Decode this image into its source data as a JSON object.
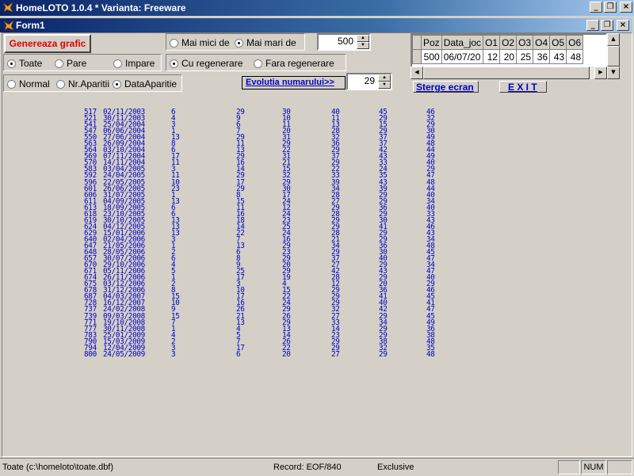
{
  "window": {
    "title": "HomeLOTO 1.0.4 * Varianta: Freeware"
  },
  "form": {
    "title": "Form1"
  },
  "window_buttons": {
    "minimize": "_",
    "restore": "❐",
    "close": "×"
  },
  "controls": {
    "generate_button": "Genereaza grafic",
    "filter_radios": {
      "all": "Toate",
      "even": "Pare",
      "odd": "Impare",
      "selected": "all"
    },
    "compare_radios": {
      "less": "Mai mici de",
      "greater": "Mai mari de",
      "selected": "greater"
    },
    "compare_value": "500",
    "regen_radios": {
      "with": "Cu regenerare",
      "without": "Fara regenerare",
      "selected": "with"
    },
    "mode_radios": {
      "normal": "Normal",
      "count": "Nr.Aparitii",
      "date": "DataAparitie",
      "selected": "date"
    },
    "evolution_button": "Evolutia numarului>>",
    "number_value": "29",
    "clear_button": "Sterge ecran",
    "exit_button": "E X I T"
  },
  "grid": {
    "columns": [
      "Poz",
      "Data_joc",
      "O1",
      "O2",
      "O3",
      "O4",
      "O5",
      "O6"
    ],
    "rows": [
      [
        "500",
        "06/07/20",
        "12",
        "20",
        "25",
        "36",
        "43",
        "48"
      ]
    ]
  },
  "draws": [
    [
      "517",
      "02/11/2003",
      "6",
      "29",
      "30",
      "40",
      "45",
      "46"
    ],
    [
      "521",
      "30/11/2003",
      "4",
      "9",
      "10",
      "11",
      "29",
      "32"
    ],
    [
      "541",
      "25/04/2004",
      "3",
      "6",
      "11",
      "13",
      "15",
      "29"
    ],
    [
      "547",
      "06/06/2004",
      "1",
      "7",
      "20",
      "28",
      "29",
      "30"
    ],
    [
      "550",
      "27/06/2004",
      "13",
      "29",
      "31",
      "32",
      "37",
      "49"
    ],
    [
      "563",
      "26/09/2004",
      "8",
      "11",
      "29",
      "36",
      "37",
      "48"
    ],
    [
      "564",
      "03/10/2004",
      "6",
      "13",
      "22",
      "29",
      "42",
      "44"
    ],
    [
      "569",
      "07/11/2004",
      "17",
      "29",
      "31",
      "37",
      "43",
      "49"
    ],
    [
      "570",
      "14/11/2004",
      "11",
      "16",
      "21",
      "29",
      "33",
      "40"
    ],
    [
      "583",
      "03/04/2005",
      "3",
      "14",
      "15",
      "22",
      "24",
      "29"
    ],
    [
      "592",
      "24/04/2005",
      "11",
      "29",
      "32",
      "33",
      "35",
      "47"
    ],
    [
      "596",
      "22/05/2005",
      "10",
      "17",
      "29",
      "39",
      "43",
      "48"
    ],
    [
      "601",
      "26/06/2005",
      "23",
      "29",
      "30",
      "34",
      "39",
      "44"
    ],
    [
      "606",
      "31/07/2005",
      "1",
      "8",
      "17",
      "28",
      "29",
      "40"
    ],
    [
      "611",
      "04/09/2005",
      "13",
      "15",
      "24",
      "27",
      "29",
      "34"
    ],
    [
      "613",
      "18/09/2005",
      "6",
      "11",
      "12",
      "29",
      "36",
      "40"
    ],
    [
      "618",
      "23/10/2005",
      "6",
      "16",
      "24",
      "28",
      "29",
      "33"
    ],
    [
      "619",
      "30/10/2005",
      "13",
      "18",
      "23",
      "29",
      "30",
      "43"
    ],
    [
      "624",
      "04/12/2005",
      "13",
      "14",
      "25",
      "29",
      "41",
      "46"
    ],
    [
      "629",
      "15/01/2006",
      "13",
      "22",
      "24",
      "28",
      "29",
      "43"
    ],
    [
      "640",
      "02/04/2006",
      "3",
      "7",
      "16",
      "21",
      "29",
      "34"
    ],
    [
      "647",
      "21/05/2006",
      "1",
      "13",
      "29",
      "34",
      "36",
      "48"
    ],
    [
      "648",
      "28/05/2006",
      "2",
      "6",
      "23",
      "29",
      "30",
      "45"
    ],
    [
      "657",
      "30/07/2006",
      "6",
      "8",
      "29",
      "37",
      "40",
      "47"
    ],
    [
      "670",
      "29/10/2006",
      "4",
      "9",
      "20",
      "27",
      "29",
      "34"
    ],
    [
      "671",
      "05/11/2006",
      "5",
      "25",
      "29",
      "42",
      "43",
      "47"
    ],
    [
      "674",
      "26/11/2006",
      "1",
      "17",
      "19",
      "28",
      "29",
      "40"
    ],
    [
      "675",
      "03/12/2006",
      "2",
      "3",
      "4",
      "12",
      "20",
      "29"
    ],
    [
      "678",
      "31/12/2006",
      "8",
      "10",
      "15",
      "29",
      "36",
      "46"
    ],
    [
      "687",
      "04/03/2007",
      "15",
      "17",
      "22",
      "29",
      "41",
      "45"
    ],
    [
      "728",
      "16/12/2007",
      "10",
      "16",
      "24",
      "29",
      "40",
      "41"
    ],
    [
      "737",
      "24/02/2008",
      "9",
      "26",
      "29",
      "32",
      "42",
      "47"
    ],
    [
      "739",
      "09/03/2008",
      "15",
      "21",
      "26",
      "27",
      "29",
      "45"
    ],
    [
      "771",
      "19/10/2008",
      "7",
      "13",
      "29",
      "33",
      "34",
      "49"
    ],
    [
      "777",
      "30/11/2008",
      "1",
      "4",
      "13",
      "14",
      "29",
      "36"
    ],
    [
      "783",
      "25/01/2009",
      "4",
      "5",
      "14",
      "23",
      "29",
      "38"
    ],
    [
      "790",
      "15/03/2009",
      "2",
      "7",
      "26",
      "29",
      "38",
      "48"
    ],
    [
      "794",
      "12/04/2009",
      "3",
      "17",
      "22",
      "29",
      "32",
      "35"
    ],
    [
      "800",
      "24/05/2009",
      "3",
      "6",
      "20",
      "27",
      "29",
      "48"
    ]
  ],
  "status": {
    "file": "Toate (c:\\homeloto\\toate.dbf)",
    "record": "Record: EOF/840",
    "mode": "Exclusive",
    "num": "NUM"
  }
}
